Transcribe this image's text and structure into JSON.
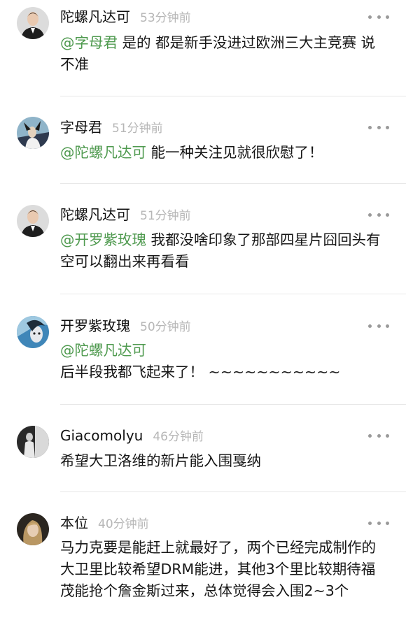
{
  "comments": [
    {
      "username": "陀螺凡达可",
      "time": "53分钟前",
      "mention": "@字母君",
      "text": " 是的 都是新手没进过欧洲三大主竞赛 说不准"
    },
    {
      "username": "字母君",
      "time": "51分钟前",
      "mention": "@陀螺凡达可",
      "text": " 能一种关注见就很欣慰了！"
    },
    {
      "username": "陀螺凡达可",
      "time": "51分钟前",
      "mention": "@开罗紫玫瑰",
      "text": " 我都没啥印象了那部四星片囧回头有空可以翻出来再看看"
    },
    {
      "username": "开罗紫玫瑰",
      "time": "50分钟前",
      "mention": "@陀螺凡达可",
      "text": "后半段我都飞起来了！ ~~~~~~~~~~~"
    },
    {
      "username": "Giacomolyu",
      "time": "46分钟前",
      "mention": "",
      "text": "希望大卫洛维的新片能入围戛纳"
    },
    {
      "username": "本位",
      "time": "40分钟前",
      "mention": "",
      "text": "马力克要是能赶上就最好了，两个已经完成制作的大卫里比较希望DRM能进，其他3个里比较期待福茂能抢个詹金斯过来，总体觉得会入围2~3个"
    }
  ],
  "icons": {
    "more": "more-dots-icon"
  },
  "colors": {
    "mention": "#4f9a4f",
    "time": "#b6b6b6",
    "divider": "#e8e8e8",
    "more_dots": "#9a9a9a"
  }
}
